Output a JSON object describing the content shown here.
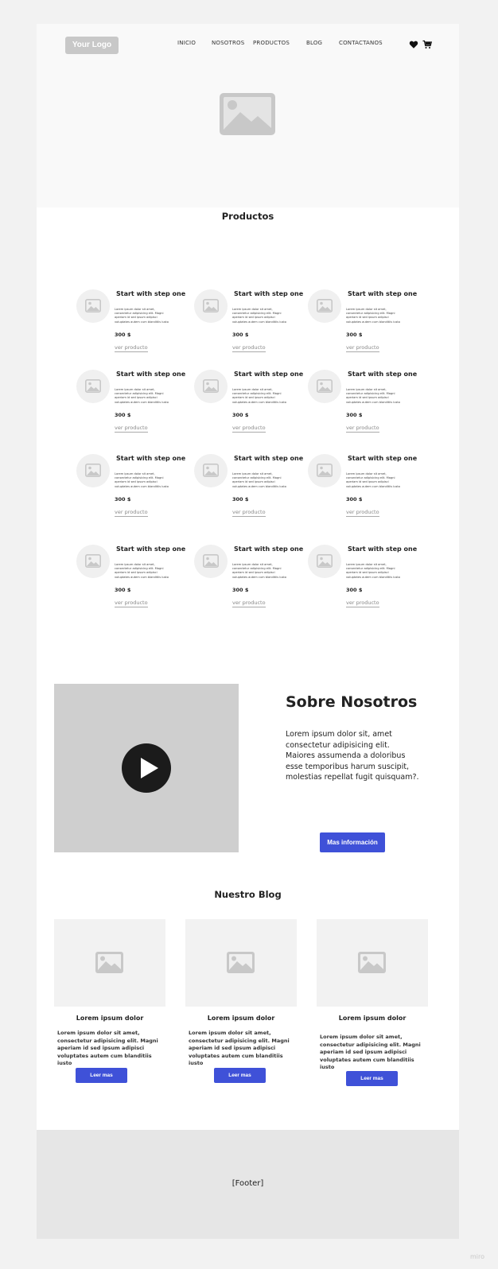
{
  "header": {
    "logo": "Your Logo",
    "nav": [
      "INICIO",
      "NOSOTROS",
      "PRODUCTOS",
      "BLOG",
      "CONTACTANOS"
    ]
  },
  "products": {
    "title": "Productos",
    "items": [
      {
        "title": "Start with step one",
        "desc": "Lorem ipsum dolor sit amet, consectetur adipisicing elit. Magni aperiam id sed ipsum adipisci voluptates autem cum blanditiis iusto",
        "price": "300 $",
        "link": "ver producto"
      },
      {
        "title": "Start with step one",
        "desc": "Lorem ipsum dolor sit amet, consectetur adipisicing elit. Magni aperiam id sed ipsum adipisci voluptates autem cum blanditiis iusto",
        "price": "300 $",
        "link": "ver producto"
      },
      {
        "title": "Start with step one",
        "desc": "Lorem ipsum dolor sit amet, consectetur adipisicing elit. Magni aperiam id sed ipsum adipisci voluptates autem cum blanditiis iusto",
        "price": "300 $",
        "link": "ver producto"
      },
      {
        "title": "Start with step one",
        "desc": "Lorem ipsum dolor sit amet, consectetur adipisicing elit. Magni aperiam id sed ipsum adipisci voluptates autem cum blanditiis iusto",
        "price": "300 $",
        "link": "ver producto"
      },
      {
        "title": "Start with step one",
        "desc": "Lorem ipsum dolor sit amet, consectetur adipisicing elit. Magni aperiam id sed ipsum adipisci voluptates autem cum blanditiis iusto",
        "price": "300 $",
        "link": "ver producto"
      },
      {
        "title": "Start with step one",
        "desc": "Lorem ipsum dolor sit amet, consectetur adipisicing elit. Magni aperiam id sed ipsum adipisci voluptates autem cum blanditiis iusto",
        "price": "300 $",
        "link": "ver producto"
      },
      {
        "title": "Start with step one",
        "desc": "Lorem ipsum dolor sit amet, consectetur adipisicing elit. Magni aperiam id sed ipsum adipisci voluptates autem cum blanditiis iusto",
        "price": "300 $",
        "link": "ver producto"
      },
      {
        "title": "Start with step one",
        "desc": "Lorem ipsum dolor sit amet, consectetur adipisicing elit. Magni aperiam id sed ipsum adipisci voluptates autem cum blanditiis iusto",
        "price": "300 $",
        "link": "ver producto"
      },
      {
        "title": "Start with step one",
        "desc": "Lorem ipsum dolor sit amet, consectetur adipisicing elit. Magni aperiam id sed ipsum adipisci voluptates autem cum blanditiis iusto",
        "price": "300 $",
        "link": "ver producto"
      },
      {
        "title": "Start with step one",
        "desc": "Lorem ipsum dolor sit amet, consectetur adipisicing elit. Magni aperiam id sed ipsum adipisci voluptates autem cum blanditiis iusto",
        "price": "300 $",
        "link": "ver producto"
      },
      {
        "title": "Start with step one",
        "desc": "Lorem ipsum dolor sit amet, consectetur adipisicing elit. Magni aperiam id sed ipsum adipisci voluptates autem cum blanditiis iusto",
        "price": "300 $",
        "link": "ver producto"
      },
      {
        "title": "Start with step one",
        "desc": "Lorem ipsum dolor sit amet, consectetur adipisicing elit. Magni aperiam id sed ipsum adipisci voluptates autem cum blanditiis iusto",
        "price": "300 $",
        "link": "ver producto"
      }
    ]
  },
  "about": {
    "title": "Sobre Nosotros",
    "text": "Lorem ipsum dolor sit, amet consectetur adipisicing elit. Maiores assumenda a doloribus esse temporibus harum suscipit, molestias repellat fugit quisquam?.",
    "button": "Mas información"
  },
  "blog": {
    "title": "Nuestro Blog",
    "posts": [
      {
        "title": "Lorem ipsum dolor",
        "text": "Lorem ipsum dolor sit amet, consectetur adipisicing elit. Magni aperiam id sed ipsum adipisci voluptates autem cum blanditiis iusto",
        "button": "Leer mas"
      },
      {
        "title": "Lorem ipsum dolor",
        "text": "Lorem ipsum dolor sit amet, consectetur adipisicing elit. Magni aperiam id sed ipsum adipisci voluptates autem cum blanditiis iusto",
        "button": "Leer mas"
      },
      {
        "title": "Lorem ipsum dolor",
        "text": "Lorem ipsum dolor sit amet, consectetur adipisicing elit. Magni aperiam id sed ipsum adipisci voluptates autem cum blanditiis iusto",
        "button": "Leer mas"
      }
    ]
  },
  "footer": {
    "label": "[Footer]"
  },
  "watermark": "miro",
  "colors": {
    "accent": "#3f51d8",
    "placeholder": "#c8c8c8",
    "footer": "#e6e6e6"
  },
  "icons": [
    "heart-icon",
    "cart-icon",
    "image-placeholder-icon",
    "play-icon"
  ]
}
